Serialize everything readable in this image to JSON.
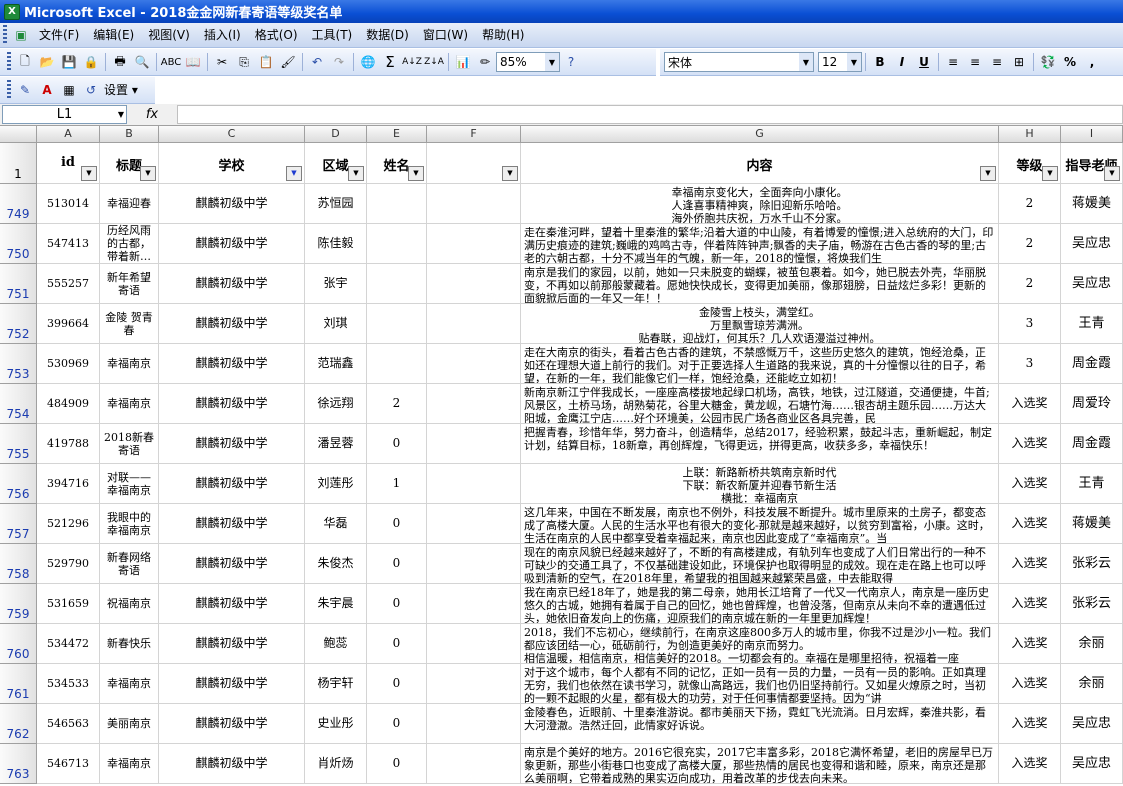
{
  "app": {
    "title": "Microsoft Excel - 2018金金网新春寄语等级奖名单"
  },
  "menu": [
    "文件(F)",
    "编辑(E)",
    "视图(V)",
    "插入(I)",
    "格式(O)",
    "工具(T)",
    "数据(D)",
    "窗口(W)",
    "帮助(H)"
  ],
  "toolbar": {
    "zoom": "85%",
    "font_name": "宋体",
    "font_size": "12",
    "settings_label": "设置"
  },
  "formula_bar": {
    "name_box": "L1",
    "fx": "fx",
    "value": ""
  },
  "columns": [
    "A",
    "B",
    "C",
    "D",
    "E",
    "F",
    "G",
    "H",
    "I"
  ],
  "header_row": {
    "row_number": "1",
    "id": "id",
    "title": "标题",
    "school": "学校",
    "district": "区域",
    "name": "姓名",
    "content": "内容",
    "grade": "等级",
    "teacher": "指导老师"
  },
  "rows": [
    {
      "row_number": "749",
      "id": "513014",
      "title": "幸福迎春",
      "school": "麒麟初级中学",
      "district": "苏恒园",
      "e": "",
      "content": "幸福南京变化大，全面奔向小康化。\n人逢喜事精神爽，除旧迎新乐哈哈。\n海外侨胞共庆祝，万水千山不分家。",
      "content_align": "center",
      "grade": "2",
      "teacher": "蒋媛美"
    },
    {
      "row_number": "750",
      "id": "547413",
      "title": "历经风雨的古都，带着新…",
      "school": "麒麟初级中学",
      "district": "陈佳毅",
      "e": "",
      "content": "走在秦淮河畔，望着十里秦淮的繁华;沿着大道的中山陵，有着博爱的憧憬;进入总统府的大门，印满历史痕迹的建筑;巍峨的鸡鸣古寺，伴着阵阵钟声;飘香的夫子庙，畅游在古色古香的琴的里;古老的六朝古都，十分不减当年的气魄，新一年，2018的憧憬，将焕我们生",
      "content_align": "left",
      "grade": "2",
      "teacher": "吴应忠"
    },
    {
      "row_number": "751",
      "id": "555257",
      "title": "新年希望寄语",
      "school": "麒麟初级中学",
      "district": "张宇",
      "e": "",
      "content": "南京是我们的家园，以前，她如一只未脱变的蝴蝶，被茧包裹着。如今，她已脱去外壳，华丽脱变，不再如以前那般蒙藏着。愿她快快成长，变得更加美丽，像那翅膀，日益炫烂多彩！更新的面貌掀后面的一年又一年！！",
      "content_align": "left",
      "grade": "2",
      "teacher": "吴应忠"
    },
    {
      "row_number": "752",
      "id": "399664",
      "title": "金陵 贺青春",
      "school": "麒麟初级中学",
      "district": "刘琪",
      "e": "",
      "content": "金陵雪上枝头，满堂红。\n万里飘雪琼芳满洲。\n贴春联，迎战灯，何其乐？几人欢语漫溢过神州。",
      "content_align": "center",
      "grade": "3",
      "teacher": "王青"
    },
    {
      "row_number": "753",
      "id": "530969",
      "title": "幸福南京",
      "school": "麒麟初级中学",
      "district": "范瑞鑫",
      "e": "",
      "content": "走在大南京的街头，看着古色古香的建筑，不禁感慨万千，这些历史悠久的建筑，饱经沧桑，正如还在理想大道上前行的我们。对于正要选择人生道路的我来说，真的十分憧憬以往的日子，希望，在新的一年，我们能像它们一样，饱经沧桑，还能屹立如初！",
      "content_align": "left",
      "grade": "3",
      "teacher": "周金霞"
    },
    {
      "row_number": "754",
      "id": "484909",
      "title": "幸福南京",
      "school": "麒麟初级中学",
      "district": "徐远翔",
      "e": "2",
      "content": "新南京新江宁伴我成长，一座座高楼拔地起绿口机场，高铁，地铁，过江隧道，交通便捷，牛首;风景区，土桥马场，胡熟菊花，谷里大糖金，黄龙岘，石塘竹海……银杏胡主题乐园……万达大阳城，金鹰江宁店……好个环境美，公园市民广场各商业区各具完善，民",
      "content_align": "left",
      "grade": "入选奖",
      "teacher": "周爱玲"
    },
    {
      "row_number": "755",
      "id": "419788",
      "title": "2018新春寄语",
      "school": "麒麟初级中学",
      "district": "潘昱蓉",
      "e": "0",
      "content": "把握青春，珍惜年华，努力奋斗，创造精华，总结2017，经验积累，鼓起斗志，重新崛起，制定计划，结算目标，18新章，再创辉煌，飞得更远，拼得更高，收获多多，幸福快乐！",
      "content_align": "left",
      "grade": "入选奖",
      "teacher": "周金霞"
    },
    {
      "row_number": "756",
      "id": "394716",
      "title": "对联——幸福南京",
      "school": "麒麟初级中学",
      "district": "刘莲彤",
      "e": "1",
      "content": "上联：新路新桥共筑南京新时代\n下联：新农新厦并迎春节新生活\n横批：幸福南京",
      "content_align": "center",
      "grade": "入选奖",
      "teacher": "王青"
    },
    {
      "row_number": "757",
      "id": "521296",
      "title": "我眼中的幸福南京",
      "school": "麒麟初级中学",
      "district": "华磊",
      "e": "0",
      "content": "这几年来，中国在不断发展，南京也不例外，科技发展不断提升。城市里原来的土房子，都变态成了高楼大厦。人民的生活水平也有很大的变化-那就是越来越好，以贫穷到富裕，小康。这时，生活在南京的人民中都享受着幸福起来，南京也因此变成了“幸福南京”。当",
      "content_align": "left",
      "grade": "入选奖",
      "teacher": "蒋媛美"
    },
    {
      "row_number": "758",
      "id": "529790",
      "title": "新春网络寄语",
      "school": "麒麟初级中学",
      "district": "朱俊杰",
      "e": "0",
      "content": "现在的南京风貌已经越来越好了，不断的有高楼建成，有轨列车也变成了人们日常出行的一种不可缺少的交通工具了，不仅基础建设如此，环境保护也取得明显的成效。现在走在路上也可以呼吸到清新的空气，在2018年里，希望我的祖国越来越繁荣昌盛，中去能取得",
      "content_align": "left",
      "grade": "入选奖",
      "teacher": "张彩云"
    },
    {
      "row_number": "759",
      "id": "531659",
      "title": "祝福南京",
      "school": "麒麟初级中学",
      "district": "朱宇晨",
      "e": "0",
      "content": "我在南京已经18年了，她是我的第二母亲，她用长江培育了一代又一代南京人，南京是一座历史悠久的古城，她拥有着属于自己的回忆，她也曾辉煌，也曾没落，但南京从未向不幸的遭遇低过头，她依旧奋发向上的伤痛，迎原我们的南京城在新的一年里更加辉煌！",
      "content_align": "left",
      "grade": "入选奖",
      "teacher": "张彩云"
    },
    {
      "row_number": "760",
      "id": "534472",
      "title": "新春快乐",
      "school": "麒麟初级中学",
      "district": "鲍蕊",
      "e": "0",
      "content": "2018，我们不忘初心，继续前行，在南京这座800多万人的城市里，你我不过是沙小一粒。我们都应该团结一心，砥砺前行，为创造更美好的南京而努力。\n相信温暖，相信南京，相信美好的2018。一切都会有的。幸福在是哪里招待，祝福着一座",
      "content_align": "left",
      "grade": "入选奖",
      "teacher": "余丽"
    },
    {
      "row_number": "761",
      "id": "534533",
      "title": "幸福南京",
      "school": "麒麟初级中学",
      "district": "杨宇轩",
      "e": "0",
      "content": "对于这个城市，每个人都有不同的记忆，正如一员有一员的力量，一员有一员的影响。正如真理无穷，我们也依然在读书学习，就像山高路远，我们也仍旧坚持前行。又如星火燎原之时，当初的一颗不起眼的火星，都有极大的功劳，对于任何事情都要坚持。因为“讲",
      "content_align": "left",
      "grade": "入选奖",
      "teacher": "余丽"
    },
    {
      "row_number": "762",
      "id": "546563",
      "title": "美丽南京",
      "school": "麒麟初级中学",
      "district": "史业彤",
      "e": "0",
      "content": "金陵春色，近眼前、十里秦淮游说。都市美丽天下扬，霓虹飞光流淌。日月宏辉，秦淮共影，看大河澄澈。浩然迁回，此情家好诉说。",
      "content_align": "left",
      "grade": "入选奖",
      "teacher": "吴应忠"
    },
    {
      "row_number": "763",
      "id": "546713",
      "title": "幸福南京",
      "school": "麒麟初级中学",
      "district": "肖炘炀",
      "e": "0",
      "content": "南京是个美好的地方。2016它很充实，2017它丰富多彩，2018它满怀希望，老旧的房屋早已万象更新，那些小街巷口也变成了高楼大厦，那些热情的居民也变得和谐和睦，原来，南京还是那么美丽啊，它带着成熟的果实迈向成功，用着改革的步伐去向未来。",
      "content_align": "left",
      "grade": "入选奖",
      "teacher": "吴应忠"
    }
  ]
}
